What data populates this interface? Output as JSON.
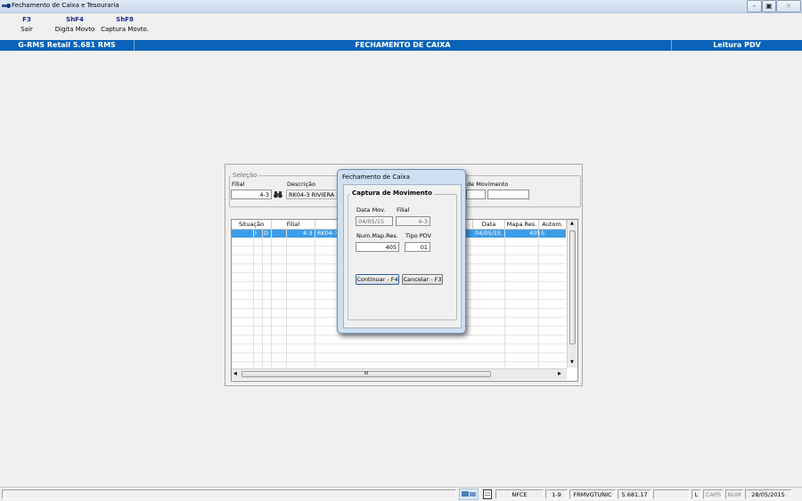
{
  "window": {
    "title": "Fechamento de Caixa e Tesouraria"
  },
  "toolbar": [
    {
      "key": "F3",
      "label": "Sair"
    },
    {
      "key": "ShF4",
      "label": "Digita Movto"
    },
    {
      "key": "ShF8",
      "label": "Captura Movto."
    }
  ],
  "header": {
    "left": "G-RMS Retail 5.681 RMS",
    "center": "FECHAMENTO DE CAIXA",
    "right": "Leitura PDV"
  },
  "selection": {
    "legend": "Seleção",
    "filial_label": "Filial",
    "filial_value": "4-3",
    "descricao_label": "Descrição",
    "descricao_value": "RK04-3 RIVIERA B",
    "movimento_label": "de Movimento",
    "search_icon": "binoculars-icon"
  },
  "grid": {
    "columns": [
      "Situação",
      "Filial",
      "Data",
      "Mapa Res.",
      "Autom."
    ],
    "selected_row": {
      "s1": "I",
      "s2": "D",
      "filial": "4-3",
      "desc": "RK04-3 R",
      "data": "04/05/15",
      "mapa": "405",
      "autom": "S"
    },
    "hscroll_mark": "III"
  },
  "dialog": {
    "title": "Fechamento de Caixa",
    "group": "Captura de Movimento",
    "data_mov_label": "Data Mov.",
    "data_mov_value": "04/05/15",
    "filial_label": "Filial",
    "filial_value": "4-3",
    "num_map_label": "Num.Map.Res.",
    "num_map_value": "405",
    "tipo_pdv_label": "Tipo PDV",
    "tipo_pdv_value": "01",
    "continue_label": "Continuar - F4",
    "cancel_label": "Cancelar - F3"
  },
  "status": {
    "nfce": "NFCE",
    "page": "1-9",
    "program": "FRMVGTUNIC",
    "version": "5.681.17",
    "l": "L",
    "caps": "CAPS",
    "num": "NUM",
    "date": "28/05/2015"
  },
  "colors": {
    "header_blue": "#0a63b8",
    "selection_blue": "#3d9de8",
    "fkey_text": "#1a2a8c"
  }
}
